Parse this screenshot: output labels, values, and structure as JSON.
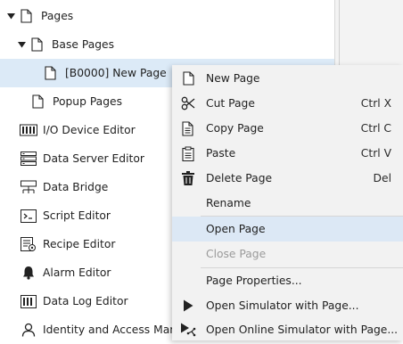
{
  "tree": {
    "nodes": [
      {
        "label": "Pages",
        "icon": "page-icon",
        "expanded": true
      },
      {
        "label": "Base Pages",
        "icon": "page-icon",
        "expanded": true
      },
      {
        "label": "[B0000] New Page",
        "icon": "page-icon",
        "selected": true
      },
      {
        "label": "Popup Pages",
        "icon": "page-icon"
      },
      {
        "label": "I/O Device Editor",
        "icon": "io-device-icon"
      },
      {
        "label": "Data Server Editor",
        "icon": "data-server-icon"
      },
      {
        "label": "Data Bridge",
        "icon": "data-bridge-icon"
      },
      {
        "label": "Script Editor",
        "icon": "script-icon"
      },
      {
        "label": "Recipe Editor",
        "icon": "recipe-icon"
      },
      {
        "label": "Alarm Editor",
        "icon": "alarm-bell-icon"
      },
      {
        "label": "Data Log Editor",
        "icon": "data-log-icon"
      },
      {
        "label": "Identity and Access Manag",
        "icon": "user-icon"
      }
    ]
  },
  "context_menu": {
    "items": [
      {
        "label": "New Page",
        "shortcut": "",
        "icon": "new-page-icon"
      },
      {
        "label": "Cut Page",
        "shortcut": "Ctrl X",
        "icon": "scissors-icon"
      },
      {
        "label": "Copy Page",
        "shortcut": "Ctrl C",
        "icon": "copy-icon"
      },
      {
        "label": "Paste",
        "shortcut": "Ctrl V",
        "icon": "clipboard-icon"
      },
      {
        "label": "Delete Page",
        "shortcut": "Del",
        "icon": "trash-icon"
      },
      {
        "label": "Rename",
        "shortcut": ""
      },
      {
        "label": "Open Page",
        "shortcut": "",
        "hovered": true
      },
      {
        "label": "Close Page",
        "shortcut": "",
        "disabled": true
      },
      {
        "label": "Page Properties...",
        "shortcut": ""
      },
      {
        "label": "Open Simulator with Page...",
        "shortcut": "",
        "icon": "play-icon"
      },
      {
        "label": "Open Online Simulator with Page...",
        "shortcut": "",
        "icon": "online-play-icon"
      }
    ]
  },
  "colors": {
    "selection": "#dceaf7",
    "menu_background": "#f2f2f2",
    "menu_hover": "#dce8f5",
    "disabled_text": "#9a9a9a"
  }
}
